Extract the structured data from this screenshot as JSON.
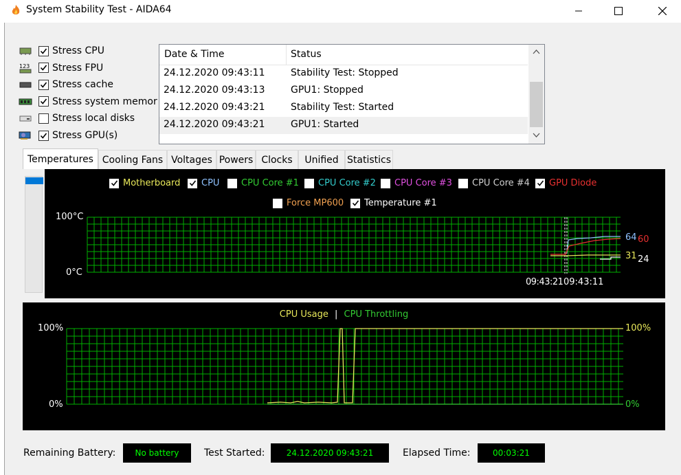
{
  "window": {
    "title": "System Stability Test - AIDA64"
  },
  "stress": [
    {
      "label": "Stress CPU",
      "checked": true,
      "icon": "cpu-chip-icon"
    },
    {
      "label": "Stress FPU",
      "checked": true,
      "icon": "fpu-123-icon"
    },
    {
      "label": "Stress cache",
      "checked": true,
      "icon": "cache-chip-icon"
    },
    {
      "label": "Stress system memor",
      "checked": true,
      "icon": "memory-module-icon"
    },
    {
      "label": "Stress local disks",
      "checked": false,
      "icon": "disk-drive-icon"
    },
    {
      "label": "Stress GPU(s)",
      "checked": true,
      "icon": "gpu-card-icon"
    }
  ],
  "log": {
    "headers": {
      "datetime": "Date & Time",
      "status": "Status"
    },
    "rows": [
      {
        "datetime": "24.12.2020 09:43:11",
        "status": "Stability Test: Stopped"
      },
      {
        "datetime": "24.12.2020 09:43:13",
        "status": "GPU1: Stopped"
      },
      {
        "datetime": "24.12.2020 09:43:21",
        "status": "Stability Test: Started"
      },
      {
        "datetime": "24.12.2020 09:43:21",
        "status": "GPU1: Started"
      }
    ]
  },
  "tabs": [
    "Temperatures",
    "Cooling Fans",
    "Voltages",
    "Powers",
    "Clocks",
    "Unified",
    "Statistics"
  ],
  "temp_legend": [
    {
      "label": "Motherboard",
      "checked": true,
      "color": "#e8e85a"
    },
    {
      "label": "CPU",
      "checked": true,
      "color": "#8fc2ff"
    },
    {
      "label": "CPU Core #1",
      "checked": false,
      "color": "#33cc33"
    },
    {
      "label": "CPU Core #2",
      "checked": false,
      "color": "#33cccc"
    },
    {
      "label": "CPU Core #3",
      "checked": false,
      "color": "#e050e0"
    },
    {
      "label": "CPU Core #4",
      "checked": false,
      "color": "#d0d0d0"
    },
    {
      "label": "GPU Diode",
      "checked": true,
      "color": "#e83030"
    },
    {
      "label": "Force MP600",
      "checked": false,
      "color": "#f0a050"
    },
    {
      "label": "Temperature #1",
      "checked": true,
      "color": "#ffffff"
    }
  ],
  "temp_axis": {
    "top": "100°C",
    "bottom": "0°C",
    "time_labels": "09:43:21",
    "time_labels2": "09:43:11"
  },
  "temp_values": [
    {
      "value": "64",
      "color": "#8fc2ff"
    },
    {
      "value": "60",
      "color": "#e83030"
    },
    {
      "value": "31",
      "color": "#e8e85a"
    },
    {
      "value": "24",
      "color": "#ffffff"
    }
  ],
  "usage_legend": {
    "usage": "CPU Usage",
    "sep": "|",
    "throttling": "CPU Throttling"
  },
  "usage_axis": {
    "left_top": "100%",
    "left_bottom": "0%",
    "right_top": "100%",
    "right_bottom": "0%"
  },
  "status": {
    "battery_label": "Remaining Battery:",
    "battery_value": "No battery",
    "started_label": "Test Started:",
    "started_value": "24.12.2020 09:43:21",
    "elapsed_label": "Elapsed Time:",
    "elapsed_value": "00:03:21"
  },
  "colors": {
    "grid": "#00b000",
    "accent": "#0078d7",
    "status_text": "#00ff00"
  }
}
